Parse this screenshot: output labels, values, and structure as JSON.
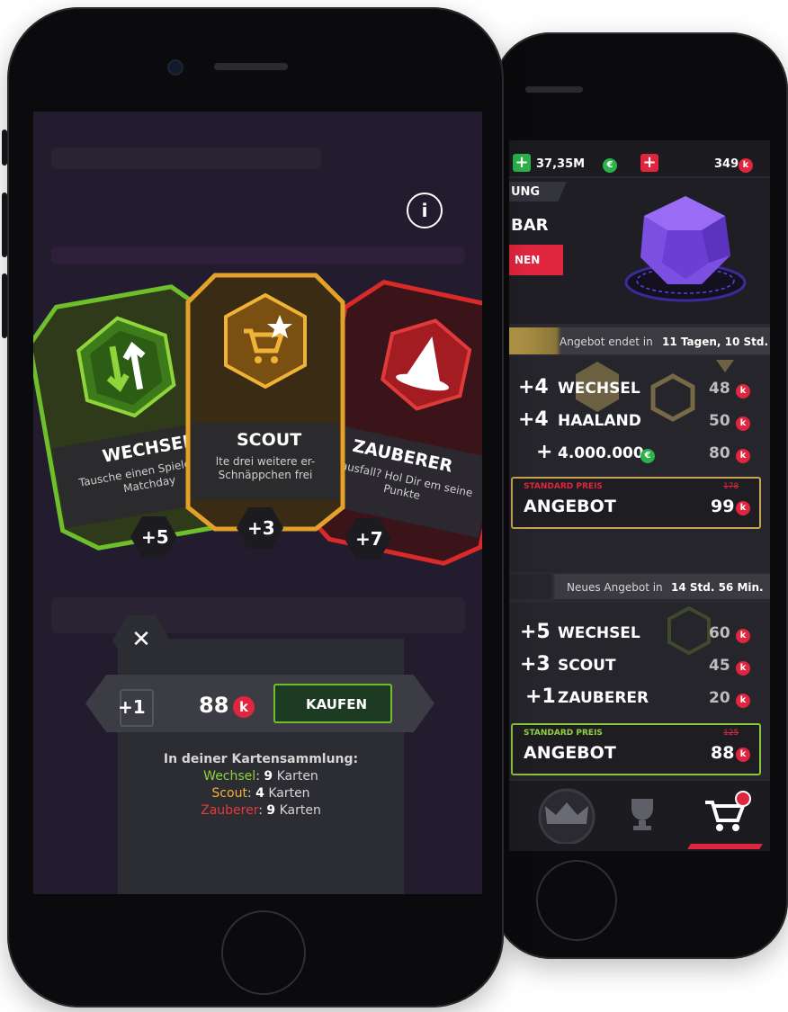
{
  "left_screen": {
    "info_icon": "info-icon",
    "cards": [
      {
        "title": "WECHSEL",
        "desc": "Tausche einen Spieler am Matchday",
        "bonus": "+5",
        "icon": "swap-arrows-icon",
        "color": "#6fbf2d"
      },
      {
        "title": "SCOUT",
        "desc": "lte drei weitere er-Schnäppchen frei",
        "bonus": "+3",
        "icon": "cart-star-icon",
        "color": "#e3a12a"
      },
      {
        "title": "ZAUBERER",
        "desc": "rausfall? Hol Dir em seine Punkte",
        "bonus": "+7",
        "icon": "wizard-hat-icon",
        "color": "#d92a2a"
      }
    ],
    "purchase": {
      "quantity": "+1",
      "price": "88",
      "currency_symbol": "k",
      "buy_label": "KAUFEN"
    },
    "collection": {
      "heading": "In deiner Kartensammlung:",
      "items": [
        {
          "name": "Wechsel",
          "count": "9",
          "unit": "Karten",
          "color": "#8fd43a"
        },
        {
          "name": "Scout",
          "count": "4",
          "unit": "Karten",
          "color": "#f0b336"
        },
        {
          "name": "Zauberer",
          "count": "9",
          "unit": "Karten",
          "color": "#e33b3b"
        }
      ]
    }
  },
  "right_screen": {
    "currency_bar": {
      "money_value": "37,35M",
      "money_symbol": "€",
      "coins_value": "349",
      "coins_symbol": "k"
    },
    "banner": {
      "tag": "UNG",
      "title": "BAR",
      "button_label": "NEN"
    },
    "offer1": {
      "timer_prefix": "Angebot endet in",
      "timer_value": "11 Tagen, 10 Std.",
      "items": [
        {
          "qty": "+4",
          "name": "WECHSEL",
          "price": "48"
        },
        {
          "qty": "+4",
          "name": "HAALAND",
          "price": "50"
        },
        {
          "qty": "+",
          "name": "4.000.000",
          "price": "80"
        }
      ],
      "standard_label": "STANDARD PREIS",
      "old_price": "178",
      "offer_label": "ANGEBOT",
      "offer_price": "99"
    },
    "offer2": {
      "timer_prefix": "Neues Angebot in",
      "timer_value": "14 Std. 56 Min.",
      "items": [
        {
          "qty": "+5",
          "name": "WECHSEL",
          "price": "60"
        },
        {
          "qty": "+3",
          "name": "SCOUT",
          "price": "45"
        },
        {
          "qty": "+1",
          "name": "ZAUBERER",
          "price": "20"
        }
      ],
      "standard_label": "STANDARD PREIS",
      "old_price": "125",
      "offer_label": "ANGEBOT",
      "offer_price": "88"
    },
    "nav": [
      "crown-icon",
      "trophy-icon",
      "cart-icon"
    ]
  }
}
